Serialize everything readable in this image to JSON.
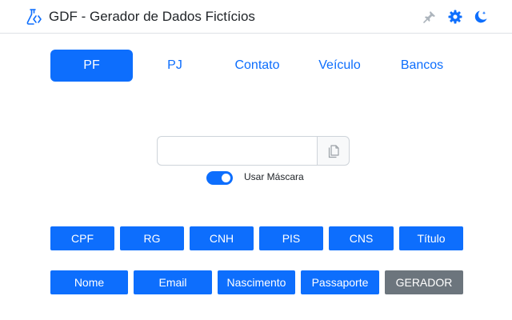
{
  "header": {
    "title": "GDF - Gerador de Dados Fictícios",
    "icons": [
      "flask-icon",
      "pin-icon",
      "gear-icon",
      "moon-icon"
    ]
  },
  "tabs": [
    {
      "label": "PF",
      "active": true
    },
    {
      "label": "PJ",
      "active": false
    },
    {
      "label": "Contato",
      "active": false
    },
    {
      "label": "Veículo",
      "active": false
    },
    {
      "label": "Bancos",
      "active": false
    }
  ],
  "result": {
    "value": "",
    "placeholder": ""
  },
  "mask_toggle": {
    "label": "Usar Máscara",
    "checked": true
  },
  "buttons_row1": [
    "CPF",
    "RG",
    "CNH",
    "PIS",
    "CNS",
    "Título"
  ],
  "buttons_row2": [
    "Nome",
    "Email",
    "Nascimento",
    "Passaporte",
    "GERADOR"
  ],
  "colors": {
    "primary": "#0d6efd",
    "secondary": "#6c757d",
    "muted_icon": "#adb5bd"
  }
}
